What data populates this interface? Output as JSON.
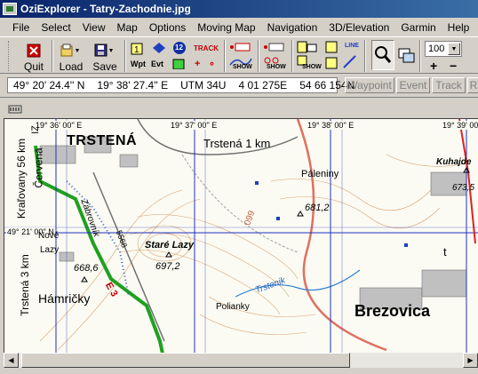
{
  "window": {
    "title": "OziExplorer - Tatry-Zachodnie.jpg"
  },
  "menu": [
    "File",
    "Select",
    "View",
    "Map",
    "Options",
    "Moving Map",
    "Navigation",
    "3D/Elevation",
    "Garmin",
    "Help"
  ],
  "toolbar": {
    "quit_label": "Quit",
    "load_label": "Load",
    "save_label": "Save",
    "wpt_label": "Wpt",
    "evt_label": "Evt",
    "track_label": "TRACK",
    "show_label": "SHOW",
    "line_label": "LINE",
    "badge_number": "12",
    "zoom_value": "100",
    "plus_label": "+",
    "minus_label": "−"
  },
  "status": {
    "lat": "49° 20' 24.4'' N",
    "lon": "19° 38' 27.4'' E",
    "utm": "UTM  34U",
    "easting": "4 01 275E",
    "northing": "54 66 154N",
    "buttons": [
      "Waypoint",
      "Event",
      "Track"
    ],
    "overflow_letter": "R"
  },
  "map": {
    "grid_labels": {
      "top": [
        "19° 36' 00'' E",
        "19° 37' 00'' E",
        "19° 38' 00'' E",
        "19° 39' 00''"
      ],
      "left": "49° 21' 00'' N"
    },
    "place_names": {
      "trstena": "TRSTENÁ",
      "trstena_1km": "Trstená 1 km",
      "paleniny": "Páleniny",
      "kuhajde": "Kuhajde",
      "elev_673": "673,5",
      "elev_681": "681,2",
      "elev_697": "697,2",
      "elev_668": "668,6",
      "stare_lazy": "Staré Lazy",
      "lazy": "Lazy",
      "novy": "Nové",
      "hamricky": "Hámričky",
      "polianky": "Polianky",
      "brezovica": "Brezovica",
      "trstenik": "Trstenik",
      "zabrovnik": "Zábrovník",
      "road_5568": "5568",
      "road_e3": "E 3",
      "road_099": "099",
      "road_t": "t",
      "left_kralovany": "Kraľovany 56 km",
      "left_cervena": "Červená",
      "left_trstena3": "Trstená 3 km",
      "left_x": "IZ"
    }
  }
}
